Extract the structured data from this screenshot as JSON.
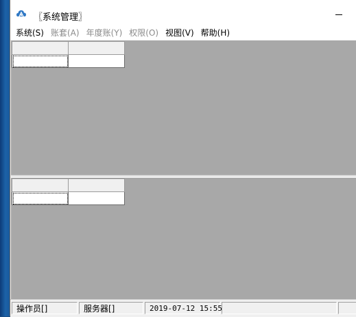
{
  "window": {
    "title": "〖系统管理〗",
    "icon": "cloud-app-icon",
    "minimize_icon": "minimize-icon"
  },
  "menu": [
    {
      "label": "系统(S)",
      "enabled": true
    },
    {
      "label": "账套(A)",
      "enabled": false
    },
    {
      "label": "年度账(Y)",
      "enabled": false
    },
    {
      "label": "权限(O)",
      "enabled": false
    },
    {
      "label": "视图(V)",
      "enabled": true
    },
    {
      "label": "帮助(H)",
      "enabled": true
    }
  ],
  "status": {
    "operator": "操作员[]",
    "server": "服务器[]",
    "datetime": "2019-07-12 15:55"
  },
  "colors": {
    "pane_background": "#a8a8a8",
    "window_chrome": "#f0f0f0",
    "desktop": "#1d4f86"
  }
}
